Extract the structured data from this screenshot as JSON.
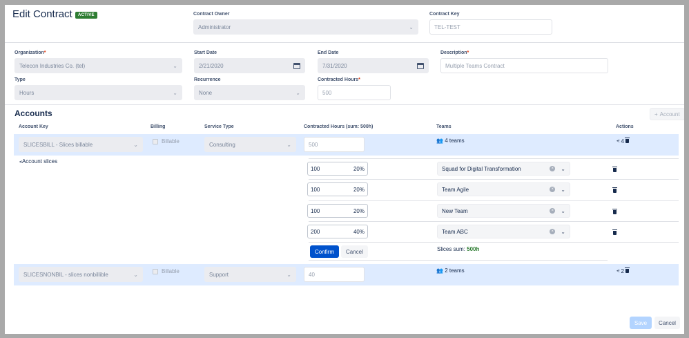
{
  "header": {
    "title": "Edit Contract",
    "status_badge": "ACTIVE",
    "owner_label": "Contract Owner",
    "owner_value": "Administrator",
    "key_label": "Contract Key",
    "key_placeholder": "TEL-TEST"
  },
  "form": {
    "organization_label": "Organization",
    "organization_value": "Telecon Industries Co. (tel)",
    "start_label": "Start Date",
    "start_value": "2/21/2020",
    "end_label": "End Date",
    "end_value": "7/31/2020",
    "description_label": "Description",
    "description_placeholder": "Multiple Teams Contract",
    "type_label": "Type",
    "type_value": "Hours",
    "recurrence_label": "Recurrence",
    "recurrence_value": "None",
    "hours_label": "Contracted Hours",
    "hours_placeholder": "500",
    "required_mark": "*"
  },
  "accounts": {
    "title": "Accounts",
    "add_button": "Account",
    "columns": {
      "key": "Account Key",
      "billing": "Billing",
      "service": "Service Type",
      "hours": "Contracted Hours (sum: 500h)",
      "teams": "Teams",
      "actions": "Actions"
    },
    "rows": [
      {
        "key": "SLICESBILL - Slices billable",
        "billing": "Billable",
        "service": "Consulting",
        "hours": "500",
        "teams": "4 teams",
        "slices_count": "4"
      },
      {
        "key": "SLICESNONBIL - slices nonbillible",
        "billing": "Billable",
        "service": "Support",
        "hours": "40",
        "teams": "2 teams",
        "slices_count": "2"
      }
    ],
    "slices": {
      "link": "Account slices",
      "items": [
        {
          "hours": "100",
          "percent": "20%",
          "team": "Squad for Digital Transformation"
        },
        {
          "hours": "100",
          "percent": "20%",
          "team": "Team Agile"
        },
        {
          "hours": "100",
          "percent": "20%",
          "team": "New Team"
        },
        {
          "hours": "200",
          "percent": "40%",
          "team": "Team ABC"
        }
      ],
      "confirm": "Confirm",
      "cancel": "Cancel",
      "sum_label": "Slices sum:",
      "sum_value": "500h"
    }
  },
  "footer": {
    "save": "Save",
    "cancel": "Cancel"
  },
  "colors": {
    "primary": "#0052cc",
    "row_highlight": "#deebff",
    "badge": "#2e7d32"
  }
}
